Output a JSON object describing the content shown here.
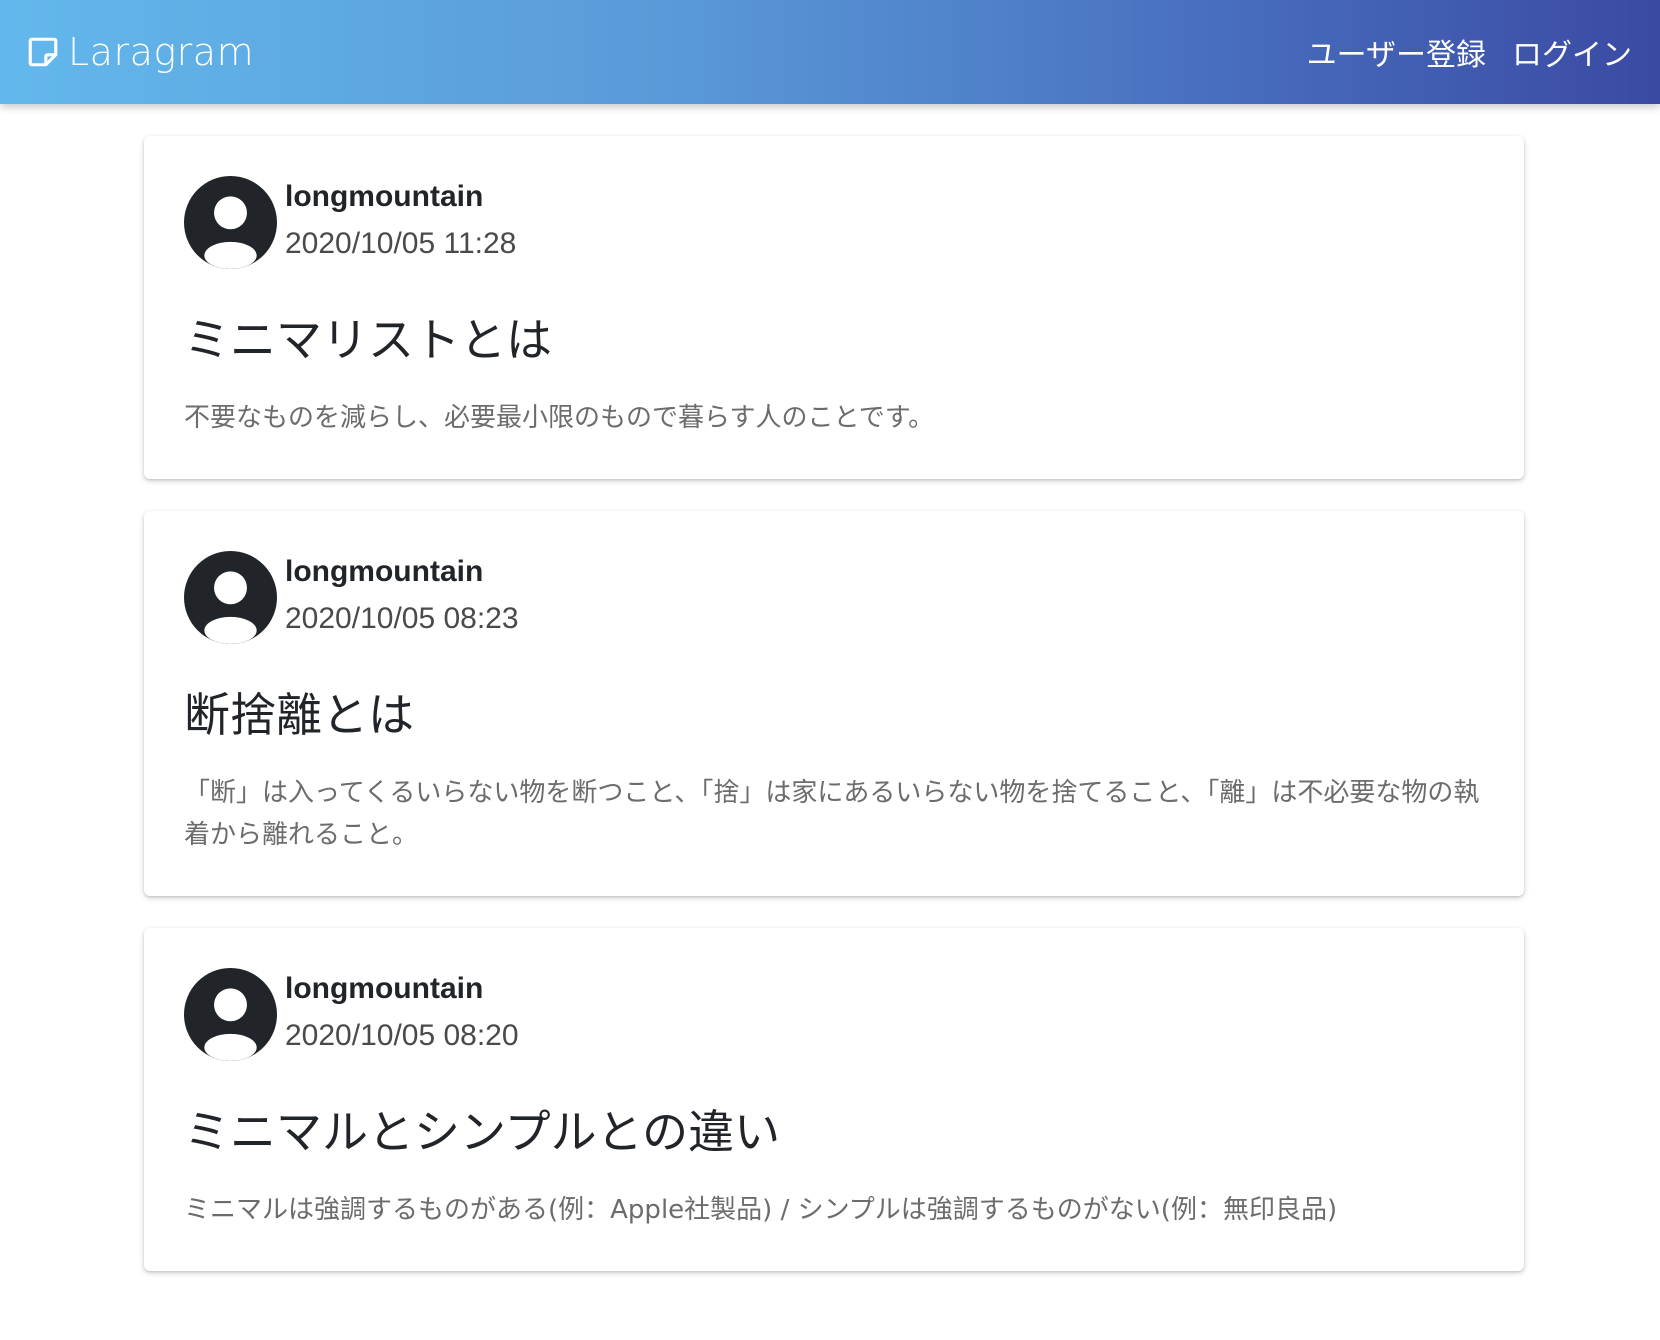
{
  "navbar": {
    "brand": "Laragram",
    "links": [
      "ユーザー登録",
      "ログイン"
    ]
  },
  "posts": [
    {
      "username": "longmountain",
      "timestamp": "2020/10/05 11:28",
      "title": "ミニマリストとは",
      "body": "不要なものを減らし、必要最小限のもので暮らす人のことです。"
    },
    {
      "username": "longmountain",
      "timestamp": "2020/10/05 08:23",
      "title": "断捨離とは",
      "body": "「断」は入ってくるいらない物を断つこと、「捨」は家にあるいらない物を捨てること、「離」は不必要な物の執着から離れること。"
    },
    {
      "username": "longmountain",
      "timestamp": "2020/10/05 08:20",
      "title": "ミニマルとシンプルとの違い",
      "body": "ミニマルは強調するものがある(例：Apple社製品) / シンプルは強調するものがない(例：無印良品)"
    }
  ],
  "icons": {
    "brand": "note-icon",
    "avatar": "account-circle-icon"
  },
  "colors": {
    "navbar_gradient_start": "#62b8ec",
    "navbar_gradient_end": "#3a4aa2",
    "avatar": "#212529",
    "body_text": "#6c6c6c"
  }
}
